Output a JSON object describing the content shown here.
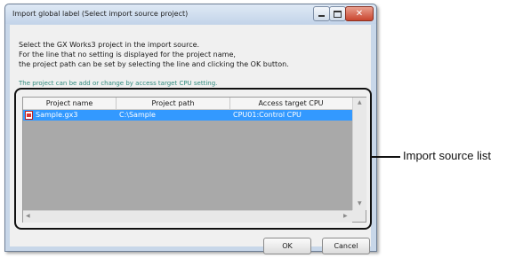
{
  "window": {
    "title": "Import global label (Select import source project)",
    "description": [
      "Select the GX Works3 project in the import source.",
      "For the line that no setting is displayed for the project name,",
      "the project path can be set by selecting the line and clicking the OK button."
    ],
    "note": "The project can be add or change by access target CPU setting."
  },
  "list": {
    "columns": [
      "Project name",
      "Project path",
      "Access target CPU"
    ],
    "rows": [
      {
        "project_name": "Sample.gx3",
        "project_path": "C:\\Sample",
        "access_target_cpu": "CPU01:Control CPU",
        "selected": true
      }
    ],
    "selection_color": "#3399ff"
  },
  "buttons": {
    "ok": "OK",
    "cancel": "Cancel"
  },
  "callout": {
    "label": "Import source list"
  },
  "icons": {
    "file": "gx3-project-file-icon"
  }
}
